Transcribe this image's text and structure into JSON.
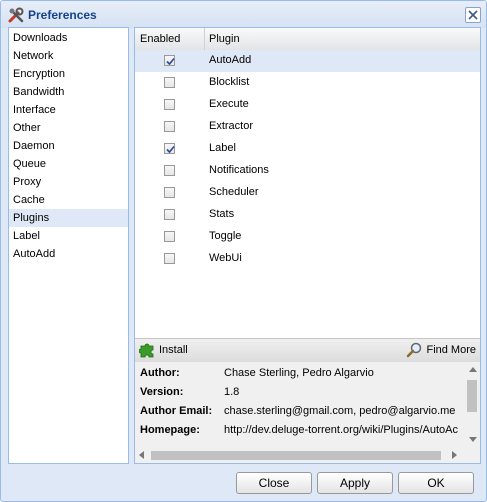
{
  "window": {
    "title": "Preferences"
  },
  "sidebar": {
    "items": [
      "Downloads",
      "Network",
      "Encryption",
      "Bandwidth",
      "Interface",
      "Other",
      "Daemon",
      "Queue",
      "Proxy",
      "Cache",
      "Plugins",
      "Label",
      "AutoAdd"
    ],
    "selected": "Plugins"
  },
  "plugins_grid": {
    "col_enabled": "Enabled",
    "col_plugin": "Plugin",
    "rows": [
      {
        "name": "AutoAdd",
        "enabled": true
      },
      {
        "name": "Blocklist",
        "enabled": false
      },
      {
        "name": "Execute",
        "enabled": false
      },
      {
        "name": "Extractor",
        "enabled": false
      },
      {
        "name": "Label",
        "enabled": true
      },
      {
        "name": "Notifications",
        "enabled": false
      },
      {
        "name": "Scheduler",
        "enabled": false
      },
      {
        "name": "Stats",
        "enabled": false
      },
      {
        "name": "Toggle",
        "enabled": false
      },
      {
        "name": "WebUi",
        "enabled": false
      }
    ]
  },
  "toolbar": {
    "install": "Install",
    "find_more": "Find More"
  },
  "info": {
    "author_label": "Author:",
    "author": "Chase Sterling, Pedro Algarvio",
    "version_label": "Version:",
    "version": "1.8",
    "email_label": "Author Email:",
    "email": "chase.sterling@gmail.com, pedro@algarvio.me",
    "homepage_label": "Homepage:",
    "homepage": "http://dev.deluge-torrent.org/wiki/Plugins/AutoAc"
  },
  "buttons": {
    "close": "Close",
    "apply": "Apply",
    "ok": "OK"
  },
  "colors": {
    "accent": "#99bbe8",
    "selection": "#dfe8f6",
    "title_text": "#15428b"
  }
}
